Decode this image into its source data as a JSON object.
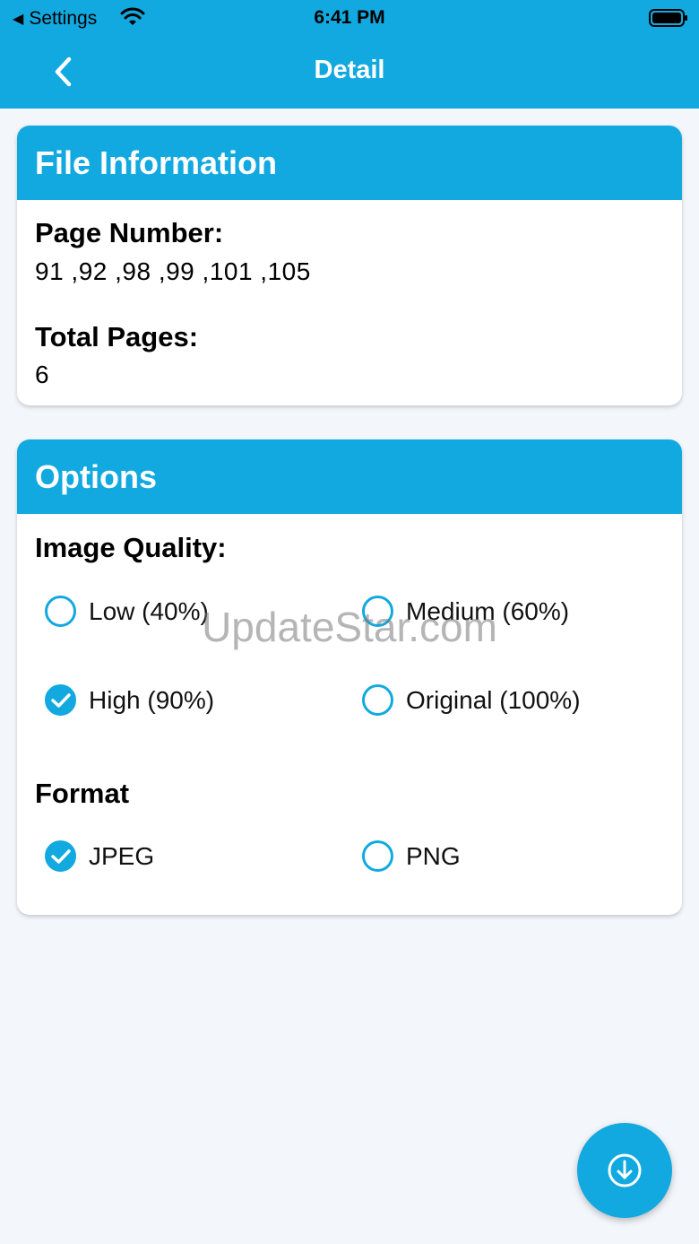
{
  "status_bar": {
    "back_app": "Settings",
    "time": "6:41 PM"
  },
  "nav": {
    "title": "Detail",
    "back_icon": "chevron-left-icon"
  },
  "file_info": {
    "title": "File Information",
    "page_number_label": "Page Number:",
    "page_number_value": "91 ,92 ,98 ,99 ,101 ,105",
    "total_pages_label": "Total Pages:",
    "total_pages_value": "6"
  },
  "options": {
    "title": "Options",
    "image_quality_label": "Image Quality:",
    "image_quality": [
      {
        "label": "Low (40%)",
        "selected": false
      },
      {
        "label": "Medium (60%)",
        "selected": false
      },
      {
        "label": "High (90%)",
        "selected": true
      },
      {
        "label": "Original (100%)",
        "selected": false
      }
    ],
    "format_label": "Format",
    "format": [
      {
        "label": "JPEG",
        "selected": true
      },
      {
        "label": "PNG",
        "selected": false
      }
    ]
  },
  "watermark": "UpdateStar.com",
  "fab": {
    "icon": "download-icon"
  },
  "colors": {
    "accent": "#12a9e0",
    "background": "#f3f7fb"
  }
}
